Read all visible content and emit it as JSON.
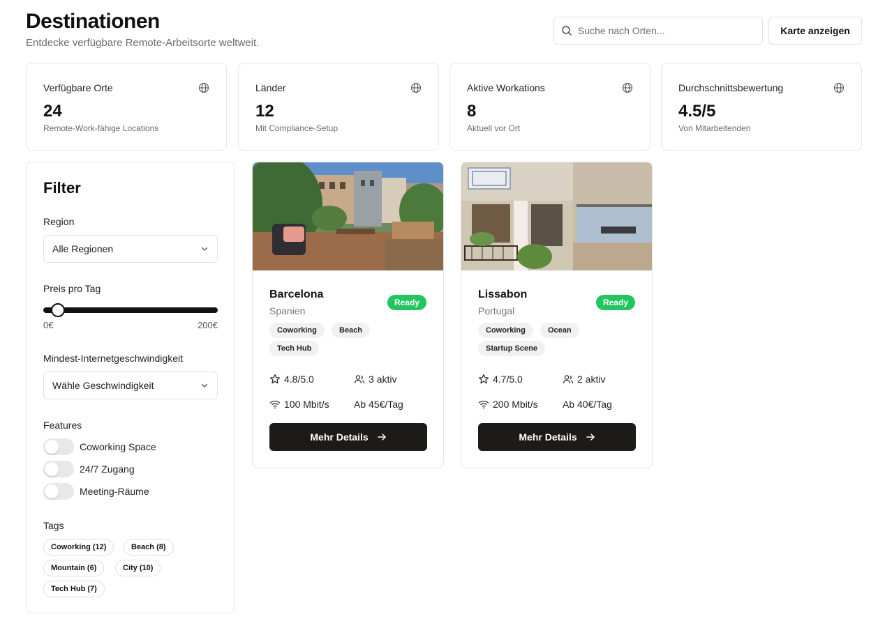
{
  "header": {
    "title": "Destinationen",
    "subtitle": "Entdecke verfügbare Remote-Arbeitsorte weltweit.",
    "search_placeholder": "Suche nach Orten...",
    "map_button": "Karte anzeigen"
  },
  "stats": [
    {
      "label": "Verfügbare Orte",
      "value": "24",
      "caption": "Remote-Work-fähige Locations",
      "icon": "globe-icon"
    },
    {
      "label": "Länder",
      "value": "12",
      "caption": "Mit Compliance-Setup",
      "icon": "globe-icon"
    },
    {
      "label": "Aktive Workations",
      "value": "8",
      "caption": "Aktuell vor Ort",
      "icon": "globe-icon"
    },
    {
      "label": "Durchschnittsbewertung",
      "value": "4.5/5",
      "caption": "Von Mitarbeitenden",
      "icon": "globe-icon"
    }
  ],
  "filter": {
    "title": "Filter",
    "region_label": "Region",
    "region_value": "Alle Regionen",
    "price_label": "Preis pro Tag",
    "price_min": "0€",
    "price_max": "200€",
    "price_slider_fraction": 0,
    "speed_label": "Mindest-Internetgeschwindigkeit",
    "speed_value": "Wähle Geschwindigkeit",
    "features_label": "Features",
    "features": [
      {
        "label": "Coworking Space",
        "on": false
      },
      {
        "label": "24/7 Zugang",
        "on": false
      },
      {
        "label": "Meeting-Räume",
        "on": false
      }
    ],
    "tags_label": "Tags",
    "tags": [
      "Coworking (12)",
      "Beach (8)",
      "Mountain (6)",
      "City (10)",
      "Tech Hub (7)"
    ]
  },
  "destinations": [
    {
      "name": "Barcelona",
      "country": "Spanien",
      "status": "Ready",
      "tags": [
        "Coworking",
        "Beach",
        "Tech Hub"
      ],
      "rating": "4.8/5.0",
      "active": "3 aktiv",
      "internet": "100 Mbit/s",
      "price": "Ab 45€/Tag",
      "button": "Mehr Details"
    },
    {
      "name": "Lissabon",
      "country": "Portugal",
      "status": "Ready",
      "tags": [
        "Coworking",
        "Ocean",
        "Startup Scene"
      ],
      "rating": "4.7/5.0",
      "active": "2 aktiv",
      "internet": "200 Mbit/s",
      "price": "Ab 40€/Tag",
      "button": "Mehr Details"
    }
  ],
  "colors": {
    "accent": "#1c1b1a",
    "ready": "#22c55e",
    "border": "#e5e5e5",
    "muted_text": "#6b6b6b"
  }
}
